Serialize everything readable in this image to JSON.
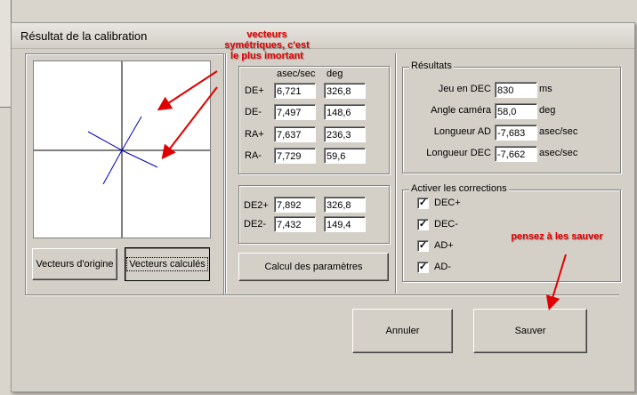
{
  "dialog": {
    "title": "Résultat de la calibration"
  },
  "plot": {
    "buttons": {
      "origin": "Vecteurs d'origine",
      "computed": "Vecteurs calculés"
    }
  },
  "table1": {
    "headers": [
      "asec/sec",
      "deg"
    ],
    "rows": [
      {
        "label": "DE+",
        "asec": "6,721",
        "deg": "326,8"
      },
      {
        "label": "DE-",
        "asec": "7,497",
        "deg": "148,6"
      },
      {
        "label": "RA+",
        "asec": "7,637",
        "deg": "236,3"
      },
      {
        "label": "RA-",
        "asec": "7,729",
        "deg": "59,6"
      }
    ]
  },
  "table2": {
    "rows": [
      {
        "label": "DE2+",
        "asec": "7,892",
        "deg": "326,8"
      },
      {
        "label": "DE2-",
        "asec": "7,432",
        "deg": "149,4"
      }
    ]
  },
  "calc_button": "Calcul des paramètres",
  "results": {
    "legend": "Résultats",
    "rows": [
      {
        "label": "Jeu en DEC",
        "value": "830",
        "unit": "ms"
      },
      {
        "label": "Angle caméra",
        "value": "58,0",
        "unit": "deg"
      },
      {
        "label": "Longueur AD",
        "value": "-7,683",
        "unit": "asec/sec"
      },
      {
        "label": "Longueur DEC",
        "value": "-7,662",
        "unit": "asec/sec"
      }
    ]
  },
  "corrections": {
    "legend": "Activer les corrections",
    "items": [
      {
        "label": "DEC+",
        "check": "✓"
      },
      {
        "label": "DEC-",
        "check": "✓"
      },
      {
        "label": "AD+",
        "check": "✓"
      },
      {
        "label": "AD-",
        "check": "✓"
      }
    ]
  },
  "buttons": {
    "cancel": "Annuler",
    "save": "Sauver"
  },
  "annotations": {
    "vectors": [
      "vecteurs",
      "symétriques, c'est",
      "le plus imortant"
    ],
    "save": "pensez à les sauver",
    "color": "#e00000"
  },
  "vector_color": "#0000c0"
}
